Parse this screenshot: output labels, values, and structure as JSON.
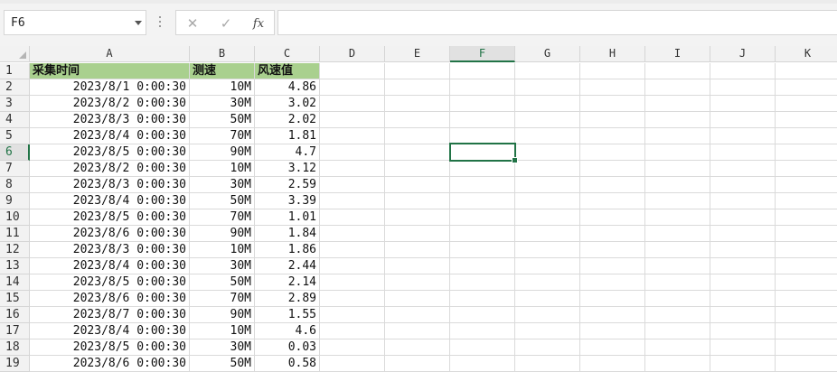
{
  "formula_bar": {
    "name_box": "F6",
    "cancel_icon": "✕",
    "enter_icon": "✓",
    "fx_label": "fx",
    "formula": ""
  },
  "active_cell": "F6",
  "columns": [
    "A",
    "B",
    "C",
    "D",
    "E",
    "F",
    "G",
    "H",
    "I",
    "J",
    "K"
  ],
  "header_row": {
    "row": "1",
    "a": "采集时间",
    "b": "测速",
    "c": "风速值"
  },
  "rows": [
    {
      "row": "2",
      "a": "2023/8/1 0:00:30",
      "b": "10M",
      "c": "4.86"
    },
    {
      "row": "3",
      "a": "2023/8/2 0:00:30",
      "b": "30M",
      "c": "3.02"
    },
    {
      "row": "4",
      "a": "2023/8/3 0:00:30",
      "b": "50M",
      "c": "2.02"
    },
    {
      "row": "5",
      "a": "2023/8/4 0:00:30",
      "b": "70M",
      "c": "1.81"
    },
    {
      "row": "6",
      "a": "2023/8/5 0:00:30",
      "b": "90M",
      "c": "4.7"
    },
    {
      "row": "7",
      "a": "2023/8/2 0:00:30",
      "b": "10M",
      "c": "3.12"
    },
    {
      "row": "8",
      "a": "2023/8/3 0:00:30",
      "b": "30M",
      "c": "2.59"
    },
    {
      "row": "9",
      "a": "2023/8/4 0:00:30",
      "b": "50M",
      "c": "3.39"
    },
    {
      "row": "10",
      "a": "2023/8/5 0:00:30",
      "b": "70M",
      "c": "1.01"
    },
    {
      "row": "11",
      "a": "2023/8/6 0:00:30",
      "b": "90M",
      "c": "1.84"
    },
    {
      "row": "12",
      "a": "2023/8/3 0:00:30",
      "b": "10M",
      "c": "1.86"
    },
    {
      "row": "13",
      "a": "2023/8/4 0:00:30",
      "b": "30M",
      "c": "2.44"
    },
    {
      "row": "14",
      "a": "2023/8/5 0:00:30",
      "b": "50M",
      "c": "2.14"
    },
    {
      "row": "15",
      "a": "2023/8/6 0:00:30",
      "b": "70M",
      "c": "2.89"
    },
    {
      "row": "16",
      "a": "2023/8/7 0:00:30",
      "b": "90M",
      "c": "1.55"
    },
    {
      "row": "17",
      "a": "2023/8/4 0:00:30",
      "b": "10M",
      "c": "4.6"
    },
    {
      "row": "18",
      "a": "2023/8/5 0:00:30",
      "b": "30M",
      "c": "0.03"
    },
    {
      "row": "19",
      "a": "2023/8/6 0:00:30",
      "b": "50M",
      "c": "0.58"
    }
  ],
  "colors": {
    "header_fill": "#a9d08e",
    "selection": "#217346"
  }
}
